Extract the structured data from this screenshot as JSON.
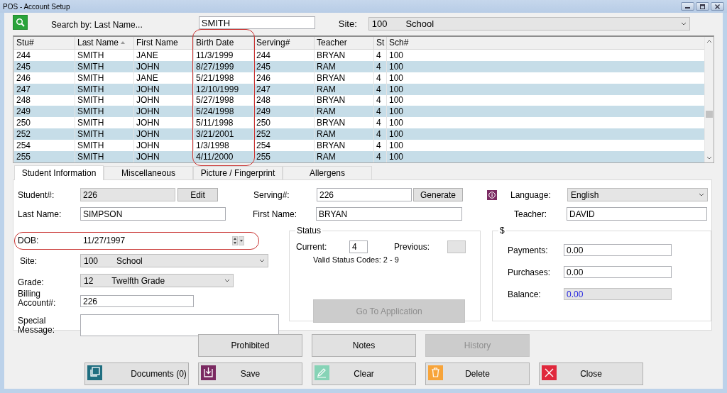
{
  "window": {
    "title": "POS - Account Setup"
  },
  "search": {
    "label": "Search by: Last Name...",
    "value": "SMITH",
    "site_label": "Site:",
    "site_code": "100",
    "site_name": "School"
  },
  "table": {
    "columns": [
      {
        "label": "Stu#",
        "sorted": false,
        "highlighted": false
      },
      {
        "label": "Last Name",
        "sorted": true,
        "highlighted": false
      },
      {
        "label": "First Name",
        "sorted": false,
        "highlighted": false
      },
      {
        "label": "Birth Date",
        "sorted": false,
        "highlighted": true
      },
      {
        "label": "Serving#",
        "sorted": false,
        "highlighted": false
      },
      {
        "label": "Teacher",
        "sorted": false,
        "highlighted": false
      },
      {
        "label": "St",
        "sorted": false,
        "highlighted": false
      },
      {
        "label": "Sch#",
        "sorted": false,
        "highlighted": false
      }
    ],
    "rows": [
      [
        "244",
        "SMITH",
        "JANE",
        "11/3/1999",
        "244",
        "BRYAN",
        "4",
        "100"
      ],
      [
        "245",
        "SMITH",
        "JOHN",
        "8/27/1999",
        "245",
        "RAM",
        "4",
        "100"
      ],
      [
        "246",
        "SMITH",
        "JANE",
        "5/21/1998",
        "246",
        "BRYAN",
        "4",
        "100"
      ],
      [
        "247",
        "SMITH",
        "JOHN",
        "12/10/1999",
        "247",
        "RAM",
        "4",
        "100"
      ],
      [
        "248",
        "SMITH",
        "JOHN",
        "5/27/1998",
        "248",
        "BRYAN",
        "4",
        "100"
      ],
      [
        "249",
        "SMITH",
        "JOHN",
        "5/24/1998",
        "249",
        "RAM",
        "4",
        "100"
      ],
      [
        "250",
        "SMITH",
        "JOHN",
        "5/11/1998",
        "250",
        "BRYAN",
        "4",
        "100"
      ],
      [
        "252",
        "SMITH",
        "JOHN",
        "3/21/2001",
        "252",
        "RAM",
        "4",
        "100"
      ],
      [
        "254",
        "SMITH",
        "JOHN",
        "1/3/1998",
        "254",
        "BRYAN",
        "4",
        "100"
      ],
      [
        "255",
        "SMITH",
        "JOHN",
        "4/11/2000",
        "255",
        "RAM",
        "4",
        "100"
      ]
    ]
  },
  "tabs": [
    {
      "label": "Student Information",
      "selected": true
    },
    {
      "label": "Miscellaneous",
      "selected": false
    },
    {
      "label": "Picture / Fingerprint",
      "selected": false
    },
    {
      "label": "Allergens",
      "selected": false
    }
  ],
  "form": {
    "student_number": {
      "label": "Student#:",
      "value": "226"
    },
    "edit_button": "Edit",
    "serving_number": {
      "label": "Serving#:",
      "value": "226"
    },
    "generate_button": "Generate",
    "language": {
      "label": "Language:",
      "value": "English"
    },
    "last_name": {
      "label": "Last Name:",
      "value": "SIMPSON"
    },
    "first_name": {
      "label": "First Name:",
      "value": "BRYAN"
    },
    "teacher": {
      "label": "Teacher:",
      "value": "DAVID"
    },
    "dob": {
      "label": "DOB:",
      "value": "11/27/1997",
      "highlighted": true
    },
    "site": {
      "label": "Site:",
      "code": "100",
      "name": "School"
    },
    "grade": {
      "label": "Grade:",
      "code": "12",
      "name": "Twelfth Grade"
    },
    "billing_account": {
      "label": "Billing Account#:",
      "value": "226"
    },
    "special_message": {
      "label": "Special Message:"
    },
    "status": {
      "title": "Status",
      "current_label": "Current:",
      "current": "4",
      "previous_label": "Previous:",
      "valid_codes": "Valid Status Codes: 2 - 9",
      "go_button": {
        "label": "Go To Application",
        "disabled": true
      }
    },
    "money": {
      "title": "$",
      "payments": {
        "label": "Payments:",
        "value": "0.00"
      },
      "purchases": {
        "label": "Purchases:",
        "value": "0.00"
      },
      "balance": {
        "label": "Balance:",
        "value": "0.00"
      }
    }
  },
  "actions": {
    "top": [
      {
        "label": "Prohibited",
        "disabled": false
      },
      {
        "label": "Notes",
        "disabled": false
      },
      {
        "label": "History",
        "disabled": true
      }
    ],
    "bottom": [
      {
        "label": "Documents (0)",
        "kind": "documents",
        "color": "#1f6e80"
      },
      {
        "label": "Save",
        "kind": "save",
        "color": "#7b2a62"
      },
      {
        "label": "Clear",
        "kind": "clear",
        "color": "#86d3b6"
      },
      {
        "label": "Delete",
        "kind": "delete",
        "color": "#f7a43a"
      },
      {
        "label": "Close",
        "kind": "close",
        "color": "#e0283c"
      }
    ]
  }
}
